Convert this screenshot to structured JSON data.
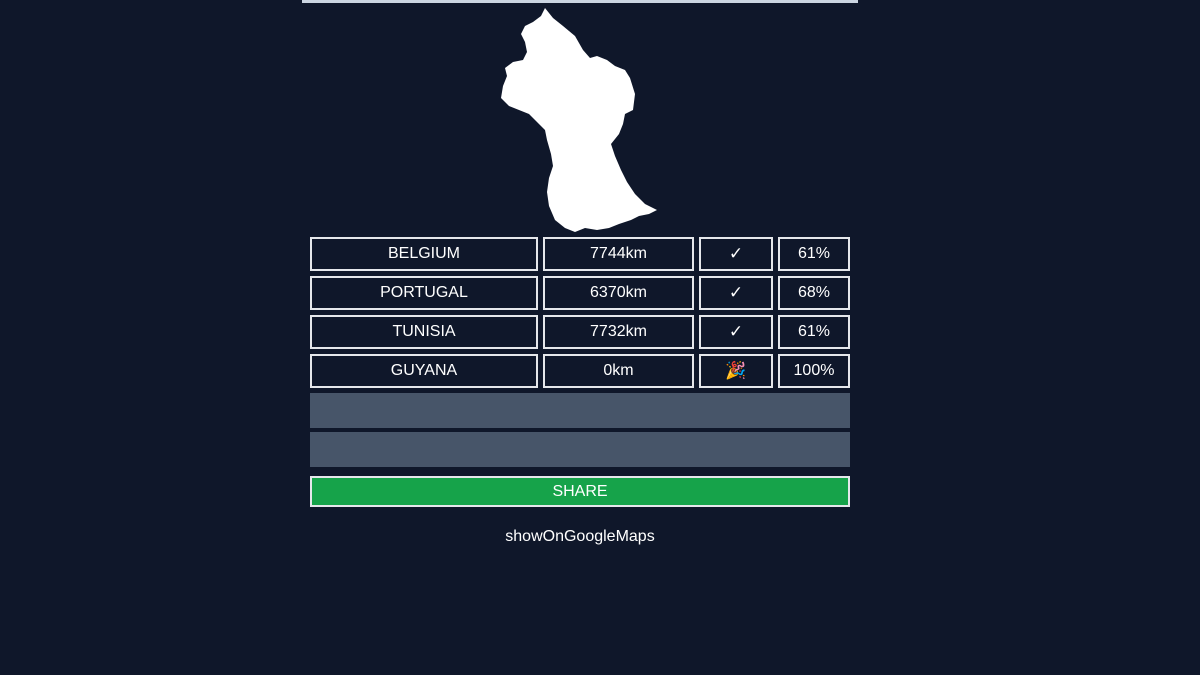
{
  "guesses": [
    {
      "country": "BELGIUM",
      "distance": "7744km",
      "direction": "✓",
      "percent": "61%"
    },
    {
      "country": "PORTUGAL",
      "distance": "6370km",
      "direction": "✓",
      "percent": "68%"
    },
    {
      "country": "TUNISIA",
      "distance": "7732km",
      "direction": "✓",
      "percent": "61%"
    },
    {
      "country": "GUYANA",
      "distance": "0km",
      "direction": "🎉",
      "percent": "100%"
    }
  ],
  "actions": {
    "share_label": "SHARE",
    "maps_link_label": "showOnGoogleMaps"
  },
  "colors": {
    "background": "#0f172a",
    "empty_row": "#475569",
    "share_button": "#16a34a",
    "border": "#e5e7eb"
  }
}
